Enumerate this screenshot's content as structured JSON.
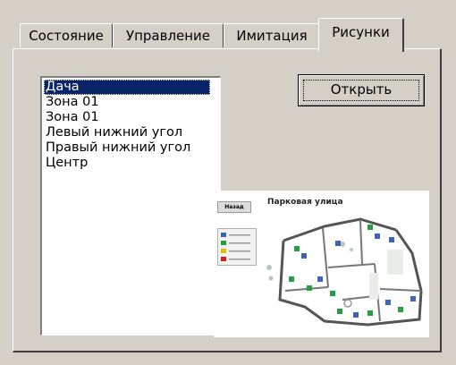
{
  "tabs": [
    {
      "label": "Состояние",
      "active": false
    },
    {
      "label": "Управление",
      "active": false
    },
    {
      "label": "Имитация",
      "active": false
    },
    {
      "label": "Рисунки",
      "active": true
    }
  ],
  "images_list": {
    "items": [
      {
        "label": "Дача",
        "selected": true
      },
      {
        "label": "Зона 01",
        "selected": false
      },
      {
        "label": "Зона 01",
        "selected": false
      },
      {
        "label": "Левый нижний угол",
        "selected": false
      },
      {
        "label": "Правый нижний угол",
        "selected": false
      },
      {
        "label": "Центр",
        "selected": false
      }
    ]
  },
  "open_button": {
    "label": "Открыть"
  },
  "preview": {
    "back_label": "Назад",
    "title": "Парковая улица"
  },
  "colors": {
    "dialog_bg": "#d4d0c8",
    "selection_bg": "#0a246a",
    "selection_text": "#ffffff"
  }
}
